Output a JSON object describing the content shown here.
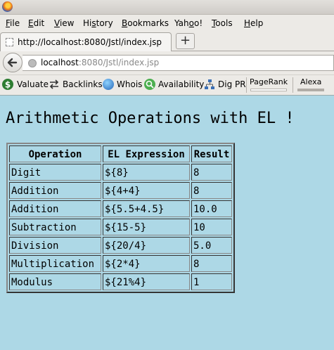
{
  "menu": [
    "File",
    "Edit",
    "View",
    "History",
    "Bookmarks",
    "Yahoo!",
    "Tools",
    "Help"
  ],
  "menu_mnemonic": [
    "F",
    "E",
    "V",
    "s",
    "B",
    "o",
    "T",
    "H"
  ],
  "tab": {
    "title": "http://localhost:8080/Jstl/index.jsp",
    "new_tab_symbol": "+"
  },
  "address": {
    "host": "localhost",
    "rest": ":8080/Jstl/index.jsp"
  },
  "seo_toolbar": {
    "items": [
      {
        "label": "Valuate",
        "icon": "dollar-icon"
      },
      {
        "label": "Backlinks",
        "icon": "backlinks-icon"
      },
      {
        "label": "Whois",
        "icon": "globe-icon"
      },
      {
        "label": "Availability",
        "icon": "search-icon"
      },
      {
        "label": "Dig PR",
        "icon": "network-icon"
      }
    ],
    "pagerank": "PageRank",
    "alexa": "Alexa"
  },
  "page": {
    "heading": "Arithmetic Operations with EL !",
    "table": {
      "headers": [
        "Operation",
        "EL Expression",
        "Result"
      ],
      "rows": [
        [
          "Digit",
          "${8}",
          "8"
        ],
        [
          "Addition",
          "${4+4}",
          "8"
        ],
        [
          "Addition",
          "${5.5+4.5}",
          "10.0"
        ],
        [
          "Subtraction",
          "${15-5}",
          "10"
        ],
        [
          "Division",
          "${20/4}",
          "5.0"
        ],
        [
          "Multiplication",
          "${2*4}",
          "8"
        ],
        [
          "Modulus",
          "${21%4}",
          "1"
        ]
      ]
    }
  },
  "colors": {
    "page_background": "#add8e6",
    "chrome": "#eceae6"
  }
}
